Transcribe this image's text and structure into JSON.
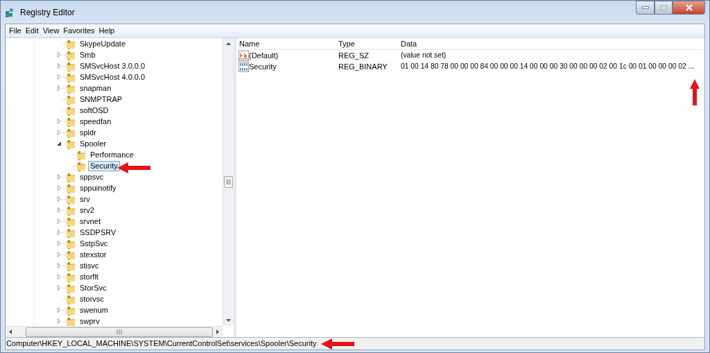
{
  "window": {
    "title": "Registry Editor"
  },
  "menu": [
    "File",
    "Edit",
    "View",
    "Favorites",
    "Help"
  ],
  "tree": {
    "items": [
      {
        "label": "SkypeUpdate",
        "selected": false
      },
      {
        "label": "Smb",
        "expanded": false,
        "selected": false
      },
      {
        "label": "SMSvcHost 3.0.0.0",
        "expanded": false,
        "selected": false
      },
      {
        "label": "SMSvcHost 4.0.0.0",
        "expanded": false,
        "selected": false
      },
      {
        "label": "snapman",
        "expanded": false,
        "selected": false
      },
      {
        "label": "SNMPTRAP",
        "selected": false
      },
      {
        "label": "softOSD",
        "selected": false
      },
      {
        "label": "speedfan",
        "expanded": false,
        "selected": false
      },
      {
        "label": "spldr",
        "expanded": false,
        "selected": false
      },
      {
        "label": "Spooler",
        "expanded": true,
        "selected": false,
        "children": [
          {
            "label": "Performance",
            "selected": false
          },
          {
            "label": "Security",
            "selected": true
          }
        ]
      },
      {
        "label": "sppsvc",
        "expanded": false,
        "selected": false
      },
      {
        "label": "sppuinotify",
        "expanded": false,
        "selected": false
      },
      {
        "label": "srv",
        "expanded": false,
        "selected": false
      },
      {
        "label": "srv2",
        "expanded": false,
        "selected": false
      },
      {
        "label": "srvnet",
        "expanded": false,
        "selected": false
      },
      {
        "label": "SSDPSRV",
        "expanded": false,
        "selected": false
      },
      {
        "label": "SstpSvc",
        "expanded": false,
        "selected": false
      },
      {
        "label": "stexstor",
        "expanded": false,
        "selected": false
      },
      {
        "label": "stisvc",
        "expanded": false,
        "selected": false
      },
      {
        "label": "storflt",
        "expanded": false,
        "selected": false
      },
      {
        "label": "StorSvc",
        "expanded": false,
        "selected": false
      },
      {
        "label": "storvsc",
        "selected": false
      },
      {
        "label": "swenum",
        "expanded": false,
        "selected": false
      },
      {
        "label": "swprv",
        "expanded": false,
        "selected": false
      }
    ]
  },
  "table": {
    "columns": [
      "Name",
      "Type",
      "Data"
    ],
    "rows": [
      {
        "kind": "string",
        "name": "(Default)",
        "type": "REG_SZ",
        "data": "(value not set)"
      },
      {
        "kind": "binary",
        "name": "Security",
        "type": "REG_BINARY",
        "data": "01 00 14 80 78 00 00 00 84 00 00 00 14 00 00 00 30 00 00 00 02 00 1c 00 01 00 00 00 02 ..."
      }
    ]
  },
  "status_bar": "Computer\\HKEY_LOCAL_MACHINE\\SYSTEM\\CurrentControlSet\\services\\Spooler\\Security"
}
